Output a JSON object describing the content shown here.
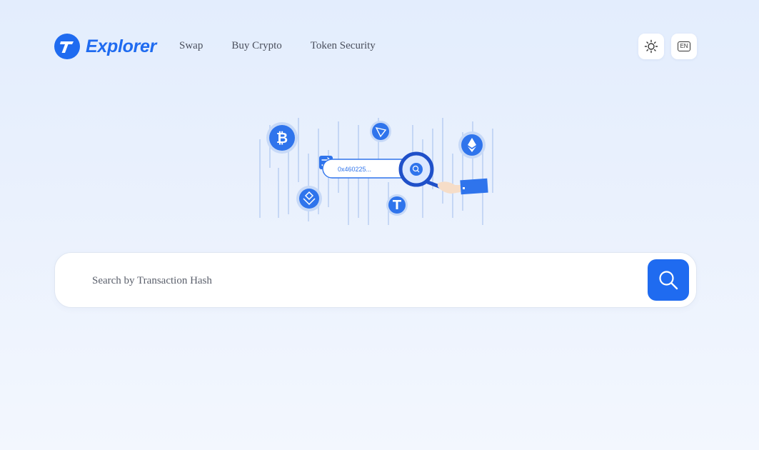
{
  "header": {
    "logo_text": "Explorer",
    "nav": [
      {
        "label": "Swap"
      },
      {
        "label": "Buy Crypto"
      },
      {
        "label": "Token Security"
      }
    ],
    "theme_icon": "sun-icon",
    "language_badge": "EN"
  },
  "illustration": {
    "mini_search_text": "0x460225..."
  },
  "search": {
    "placeholder": "Search by Transaction Hash",
    "button_icon": "search-icon"
  },
  "colors": {
    "accent": "#1f6bf0",
    "background_top": "#e3edfd",
    "background_bottom": "#f3f7fe",
    "nav_text": "#4a4f5c"
  }
}
